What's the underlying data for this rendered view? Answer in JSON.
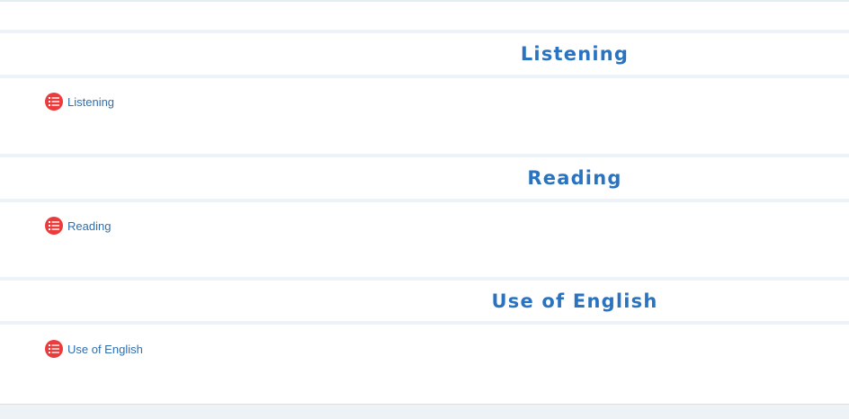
{
  "sections": [
    {
      "title": "Listening",
      "items": [
        {
          "label": "Listening",
          "icon": "list-icon"
        }
      ]
    },
    {
      "title": "Reading",
      "items": [
        {
          "label": "Reading",
          "icon": "list-icon"
        }
      ]
    },
    {
      "title": "Use of English",
      "items": [
        {
          "label": "Use of English",
          "icon": "list-icon"
        }
      ]
    }
  ],
  "colors": {
    "section_title": "#2a73c0",
    "item_label": "#2f6fae",
    "icon_background": "#ec3b3b",
    "separator": "#edf3f8"
  }
}
